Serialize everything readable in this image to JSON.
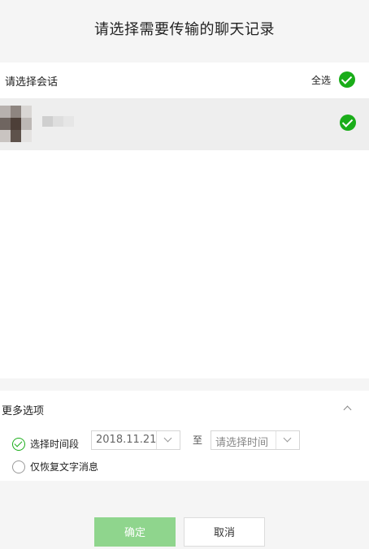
{
  "title": "请选择需要传输的聊天记录",
  "section": {
    "label": "请选择会话",
    "select_all": "全选"
  },
  "chat_list": {
    "items": [
      {
        "selected": true,
        "avatar_icon": "blurred-avatar-icon"
      }
    ]
  },
  "options": {
    "header": "更多选项",
    "time_range": {
      "label": "选择时间段",
      "checked": true,
      "start_value": "2018.11.21",
      "separator": "至",
      "end_placeholder": "请选择时间"
    },
    "text_only": {
      "label": "仅恢复文字消息",
      "checked": false
    }
  },
  "buttons": {
    "confirm": "确定",
    "cancel": "取消"
  },
  "colors": {
    "accent": "#1aad19",
    "confirm_disabled": "#8fd58d",
    "background": "#f5f5f5"
  }
}
